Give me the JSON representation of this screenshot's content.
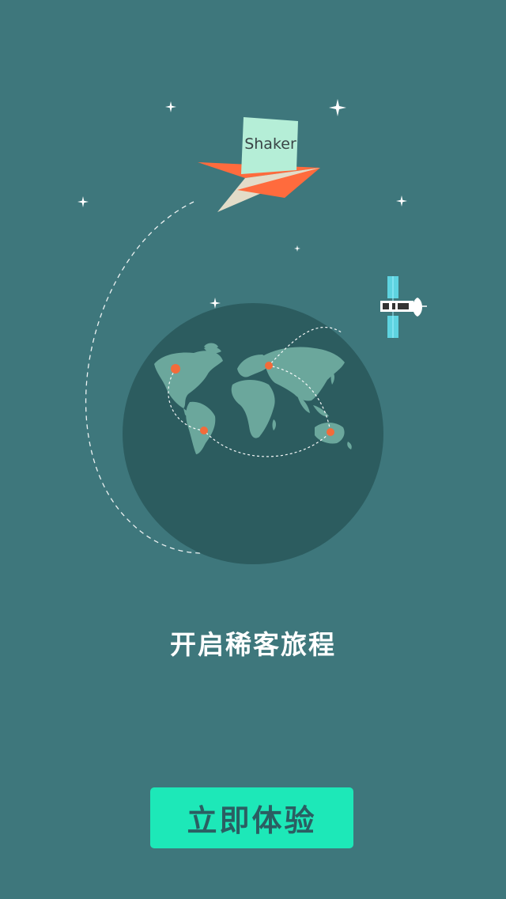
{
  "illustration": {
    "plane_tag": "Shaker",
    "icons": [
      "paper-plane-icon",
      "satellite-icon",
      "globe-icon",
      "star-icon"
    ],
    "colors": {
      "background": "#3e777c",
      "globe": "#2c5c5f",
      "continents": "#6ba79c",
      "markers": "#f26b3a",
      "plane_orange": "#ff6b3d",
      "plane_cream": "#e3dcc8",
      "tag": "#b5eed7"
    }
  },
  "tagline": "开启稀客旅程",
  "cta": {
    "label": "立即体验",
    "color": "#1de8b8"
  }
}
